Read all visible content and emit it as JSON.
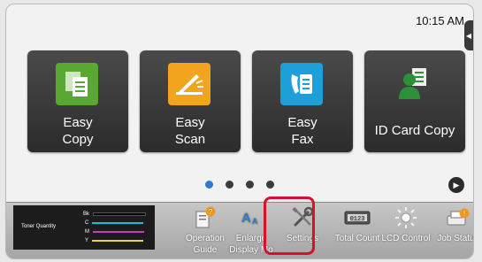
{
  "status": {
    "time": "10:15 AM"
  },
  "tiles": [
    {
      "label_line1": "Easy",
      "label_line2": "Copy",
      "icon": "copy-icon",
      "color": "#5aa832"
    },
    {
      "label_line1": "Easy",
      "label_line2": "Scan",
      "icon": "scan-icon",
      "color": "#f2a41e"
    },
    {
      "label_line1": "Easy",
      "label_line2": "Fax",
      "icon": "fax-icon",
      "color": "#1d9fd8"
    },
    {
      "label_line1": "ID Card Copy",
      "icon": "id-card-copy-icon",
      "color": "#2e8f3a"
    }
  ],
  "pager": {
    "pages": 4,
    "active": 1
  },
  "toner": {
    "label": "Toner Quantity",
    "rows": [
      {
        "name": "Bk",
        "color": "#000000"
      },
      {
        "name": "C",
        "color": "#1fbcd8"
      },
      {
        "name": "M",
        "color": "#c23fb5"
      },
      {
        "name": "Y",
        "color": "#e6d82e"
      }
    ]
  },
  "toolbar": {
    "operation_guide_1": "Operation",
    "operation_guide_2": "Guide",
    "enlarge_display_1": "Enlarge",
    "enlarge_display_2": "Display Mo",
    "settings": "Settings",
    "total_count": "Total Count",
    "lcd_control": "LCD Control",
    "job_status": "Job Status"
  },
  "colors": {
    "highlight": "#d4122e",
    "active_dot": "#2d7bd4"
  }
}
